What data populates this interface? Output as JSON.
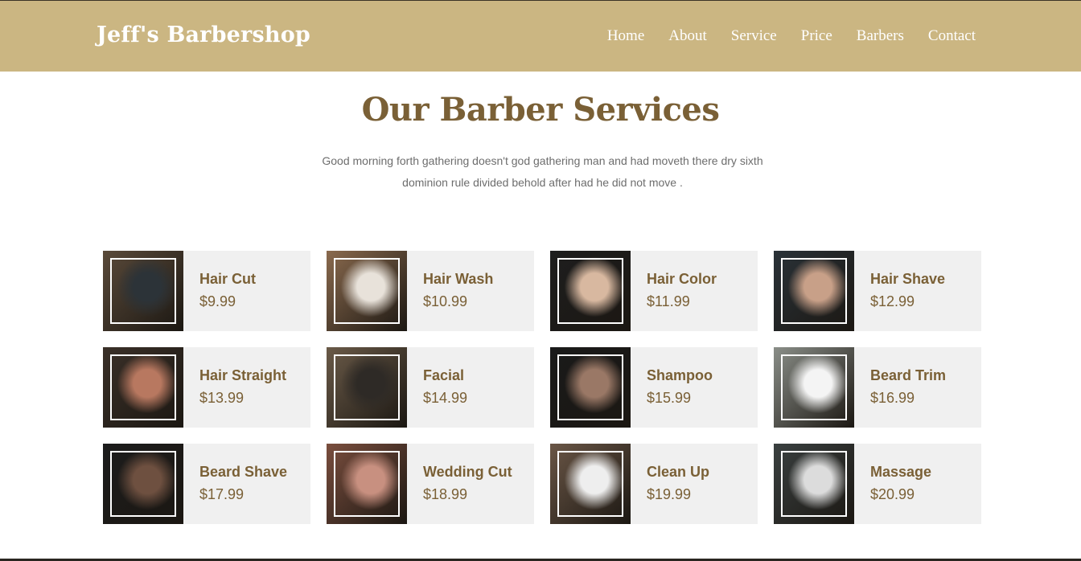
{
  "header": {
    "logo": "Jeff's Barbershop",
    "nav": [
      {
        "label": "Home",
        "name": "nav-home"
      },
      {
        "label": "About",
        "name": "nav-about"
      },
      {
        "label": "Service",
        "name": "nav-service"
      },
      {
        "label": "Price",
        "name": "nav-price"
      },
      {
        "label": "Barbers",
        "name": "nav-barbers"
      },
      {
        "label": "Contact",
        "name": "nav-contact"
      }
    ]
  },
  "services": {
    "title": "Our Barber Services",
    "description": "Good morning forth gathering doesn't god gathering man and had moveth there dry sixth dominion rule divided behold after had he did not move .",
    "items": [
      {
        "name": "Hair Cut",
        "price": "$9.99",
        "slug": "hair-cut",
        "photo_bg": "#5a4a3a",
        "photo_fg": "#2c3338"
      },
      {
        "name": "Hair Wash",
        "price": "$10.99",
        "slug": "hair-wash",
        "photo_bg": "#8a6a4e",
        "photo_fg": "#e8e2da"
      },
      {
        "name": "Hair Color",
        "price": "$11.99",
        "slug": "hair-color",
        "photo_bg": "#1e1e1e",
        "photo_fg": "#d8b8a0"
      },
      {
        "name": "Hair Shave",
        "price": "$12.99",
        "slug": "hair-shave",
        "photo_bg": "#2a3238",
        "photo_fg": "#c8a088"
      },
      {
        "name": "Hair Straight",
        "price": "$13.99",
        "slug": "hair-straight",
        "photo_bg": "#3a3028",
        "photo_fg": "#b87860"
      },
      {
        "name": "Facial",
        "price": "$14.99",
        "slug": "facial",
        "photo_bg": "#6a5a48",
        "photo_fg": "#2e2a26"
      },
      {
        "name": "Shampoo",
        "price": "$15.99",
        "slug": "shampoo",
        "photo_bg": "#1a1a1a",
        "photo_fg": "#9a7866"
      },
      {
        "name": "Beard Trim",
        "price": "$16.99",
        "slug": "beard-trim",
        "photo_bg": "#8a8e88",
        "photo_fg": "#f4f4f4"
      },
      {
        "name": "Beard Shave",
        "price": "$17.99",
        "slug": "beard-shave",
        "photo_bg": "#1c1c1c",
        "photo_fg": "#6e5040"
      },
      {
        "name": "Wedding Cut",
        "price": "$18.99",
        "slug": "wedding-cut",
        "photo_bg": "#7a4e3e",
        "photo_fg": "#c89080"
      },
      {
        "name": "Clean Up",
        "price": "$19.99",
        "slug": "clean-up",
        "photo_bg": "#6a5646",
        "photo_fg": "#eeeeee"
      },
      {
        "name": "Massage",
        "price": "$20.99",
        "slug": "massage",
        "photo_bg": "#3a4040",
        "photo_fg": "#dcdcdc"
      }
    ]
  },
  "colors": {
    "header_bg": "#cbb682",
    "accent": "#7a6036",
    "card_bg": "#f0f0f0",
    "body_text": "#6d6d6d"
  }
}
